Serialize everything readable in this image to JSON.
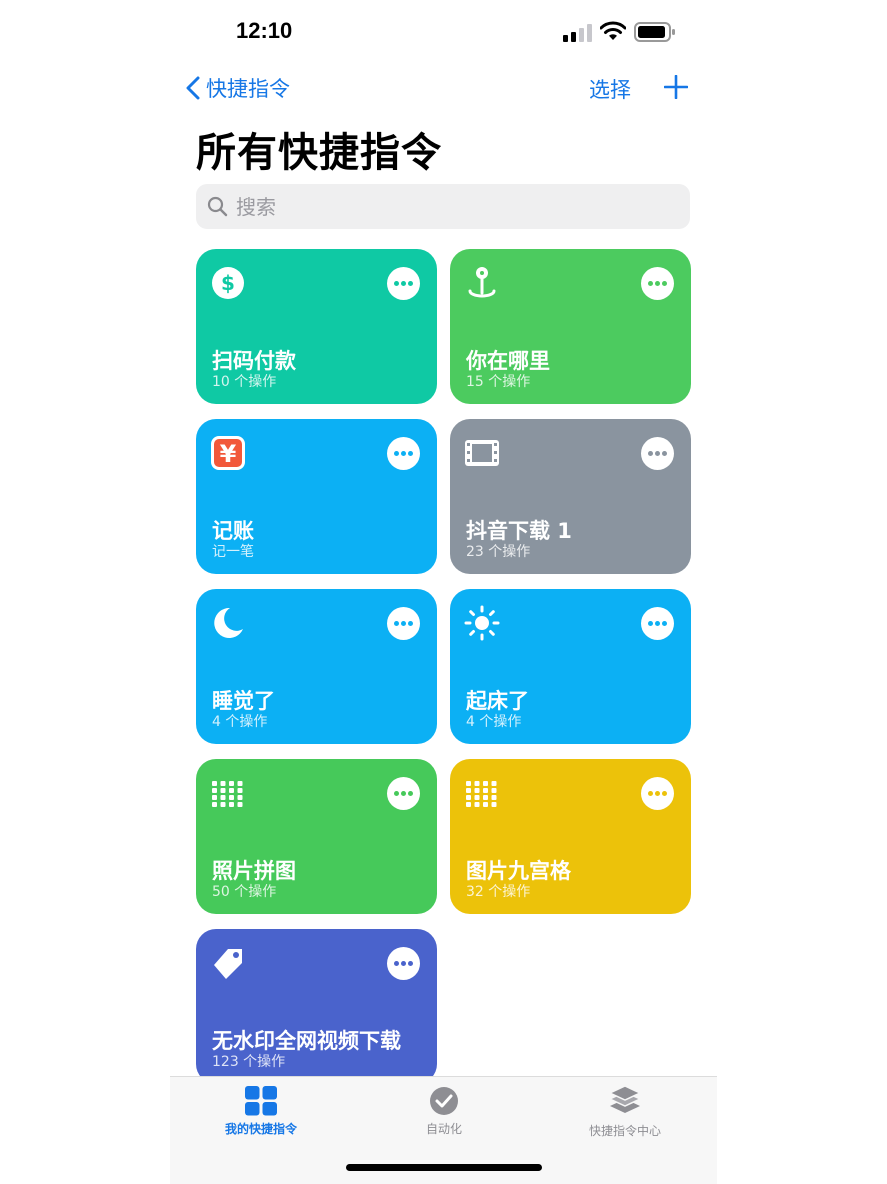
{
  "status": {
    "time": "12:10"
  },
  "nav": {
    "back_label": "快捷指令",
    "select_label": "选择"
  },
  "page": {
    "title": "所有快捷指令"
  },
  "search": {
    "placeholder": "搜索"
  },
  "shortcuts": [
    {
      "title": "扫码付款",
      "subtitle": "10 个操作",
      "icon": "dollar-icon",
      "color": "#0fc9a4"
    },
    {
      "title": "你在哪里",
      "subtitle": "15 个操作",
      "icon": "location-pin-icon",
      "color": "#4ccb5f"
    },
    {
      "title": "记账",
      "subtitle": "记一笔",
      "icon": "yuan-app-icon",
      "color": "#0cb0f4"
    },
    {
      "title": "抖音下载 1",
      "subtitle": "23 个操作",
      "icon": "film-icon",
      "color": "#8a949f"
    },
    {
      "title": "睡觉了",
      "subtitle": "4 个操作",
      "icon": "moon-icon",
      "color": "#0cb0f4"
    },
    {
      "title": "起床了",
      "subtitle": "4 个操作",
      "icon": "sun-icon",
      "color": "#0cb0f4"
    },
    {
      "title": "照片拼图",
      "subtitle": "50 个操作",
      "icon": "grid-icon",
      "color": "#46c95a"
    },
    {
      "title": "图片九宫格",
      "subtitle": "32 个操作",
      "icon": "grid-icon",
      "color": "#ecc20a"
    },
    {
      "title": "无水印全网视频下载",
      "subtitle": "123 个操作",
      "icon": "tag-icon",
      "color": "#4a63cc"
    }
  ],
  "tabs": [
    {
      "label": "我的快捷指令",
      "icon": "my-shortcuts-icon",
      "active": true
    },
    {
      "label": "自动化",
      "icon": "automation-icon",
      "active": false
    },
    {
      "label": "快捷指令中心",
      "icon": "gallery-icon",
      "active": false
    }
  ],
  "colors": {
    "accent": "#1677e6",
    "tab_inactive": "#8e8e93"
  }
}
